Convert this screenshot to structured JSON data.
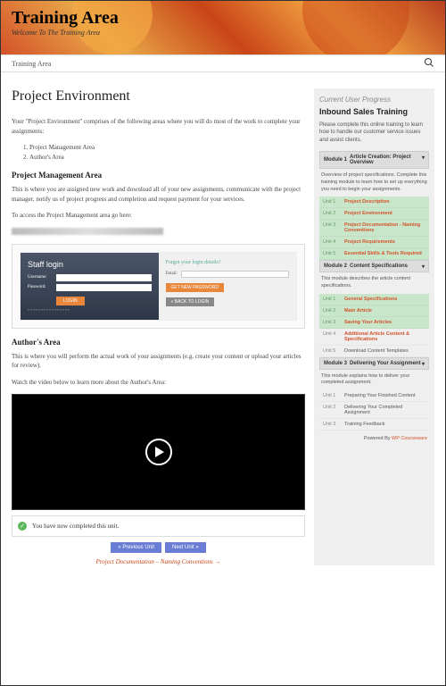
{
  "header": {
    "title": "Training Area",
    "subtitle": "Welcome To The Training Area"
  },
  "navbar": {
    "link": "Training Area"
  },
  "main": {
    "title": "Project Environment",
    "intro": "Your \"Project Environment\" comprises of the following areas where you will do most of the work to complete your assignments:",
    "list": [
      "Project Management Area",
      "Author's Area"
    ],
    "pma": {
      "heading": "Project Management Area",
      "text": "This is where you are assigned new work and download all of your new assignments, communicate with the project manager, notify us of project progress and completion and request payment for your services.",
      "access": "To access the Project Management area go here:"
    },
    "staff": {
      "title": "Staff login",
      "username_label": "Username:",
      "password_label": "Password:",
      "login_btn": "LOGIN",
      "forgot": "Forgot your login details?",
      "email_label": "Email:",
      "get_btn": "GET NEW PASSWORD",
      "continue_btn": "« BACK TO LOGIN"
    },
    "authors": {
      "heading": "Author's Area",
      "text": "This is where you will perform the actual work of your assignments (e.g. create your content or upload your articles for review).",
      "watch": "Watch the video below to learn more about the Author's Area:"
    },
    "completed": "You have now completed this unit.",
    "prev_btn": "« Previous Unit",
    "next_btn": "Next Unit »",
    "next_link": "Project Documentation – Naming Conventions →"
  },
  "sidebar": {
    "current": "Current User Progress",
    "title": "Inbound Sales Training",
    "intro": "Please complete this online training to learn how to handle our customer service issues and assist clients.",
    "modules": [
      {
        "num": "Module 1",
        "title": "Article Creation: Project Overview",
        "desc": "Overview of project specifications. Complete this training module to learn how to set up everything you need to begin your assignments.",
        "units": [
          {
            "n": "Unit 1",
            "t": "Project Description",
            "done": true
          },
          {
            "n": "Unit 2",
            "t": "Project Environment",
            "done": true
          },
          {
            "n": "Unit 3",
            "t": "Project Documentation - Naming Conventions",
            "done": true
          },
          {
            "n": "Unit 4",
            "t": "Project Requirements",
            "done": true
          },
          {
            "n": "Unit 5",
            "t": "Essential Skills & Tools Required",
            "done": true
          }
        ]
      },
      {
        "num": "Module 2",
        "title": "Content Specifications",
        "desc": "This module describes the article content specifications.",
        "units": [
          {
            "n": "Unit 1",
            "t": "General Specifications",
            "done": true
          },
          {
            "n": "Unit 2",
            "t": "Main Article",
            "done": true
          },
          {
            "n": "Unit 3",
            "t": "Saving Your Articles",
            "done": true
          },
          {
            "n": "Unit 4",
            "t": "Additional Article Content & Specifications",
            "done": false,
            "orange": true
          },
          {
            "n": "Unit 5",
            "t": "Download Content Templates",
            "done": false,
            "plain": true
          }
        ]
      },
      {
        "num": "Module 3",
        "title": "Delivering Your Assignment",
        "desc": "This module explains how to deliver your completed assignment.",
        "units": [
          {
            "n": "Unit 1",
            "t": "Preparing Your Finished Content",
            "done": false,
            "plain": true
          },
          {
            "n": "Unit 2",
            "t": "Delivering Your Completed Assignment",
            "done": false,
            "plain": true
          },
          {
            "n": "Unit 3",
            "t": "Training Feedback",
            "done": false,
            "plain": true
          }
        ]
      }
    ],
    "powered_label": "Powered By ",
    "powered_by": "WP Courseware"
  }
}
